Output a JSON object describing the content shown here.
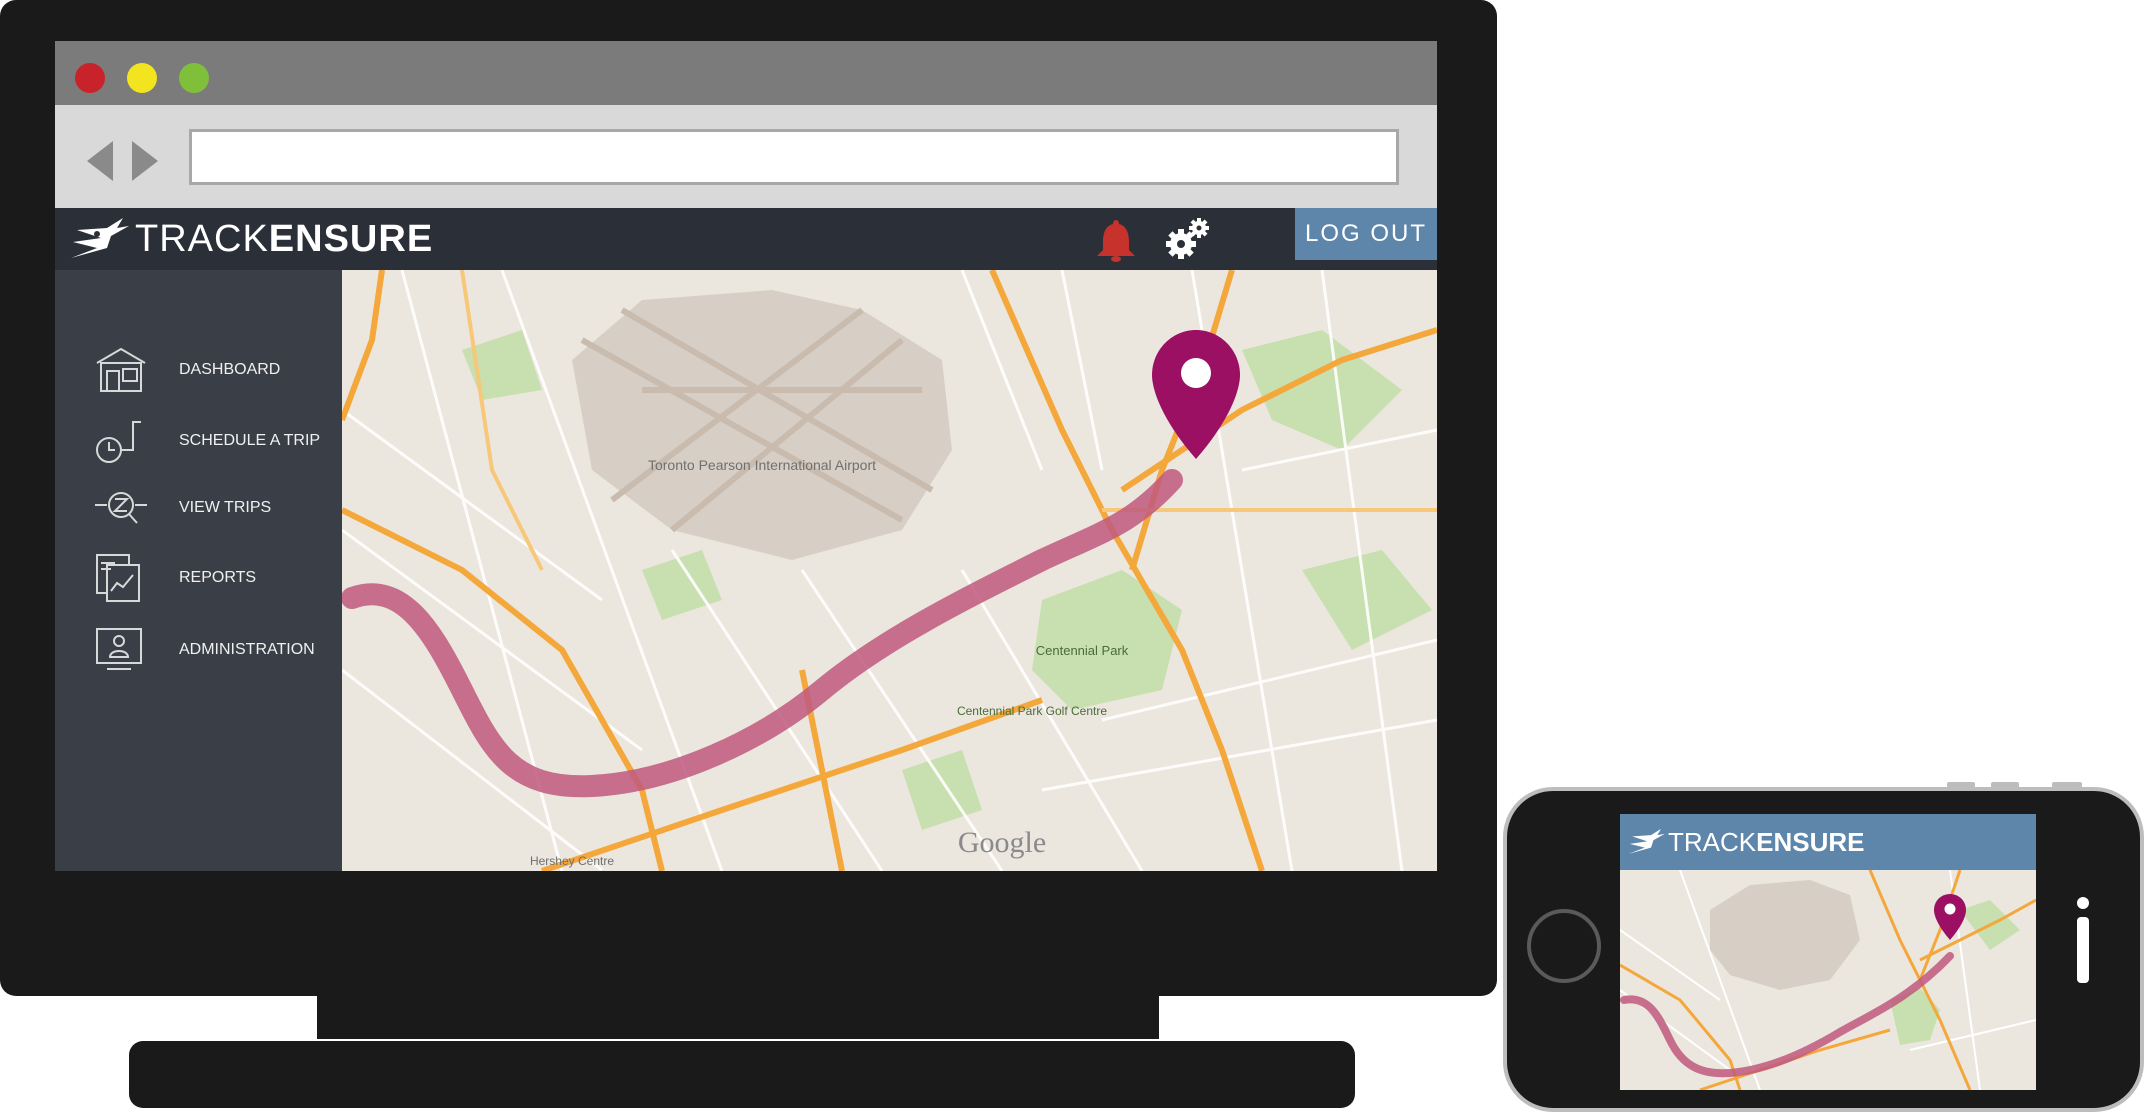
{
  "app": {
    "brand_light": "TRACK",
    "brand_bold": "ENSURE",
    "logout_label": "LOG OUT",
    "colors": {
      "header_bg": "#2b2f37",
      "sidebar_bg": "#3a3f47",
      "accent_blue": "#5e86aa",
      "pin_purple": "#9c1063",
      "route_pink": "#c0587e",
      "bell_red": "#c8322c"
    }
  },
  "browser": {
    "url_value": ""
  },
  "header": {
    "icons": [
      "bell-icon",
      "settings-gears-icon"
    ]
  },
  "sidebar": {
    "items": [
      {
        "label": "DASHBOARD",
        "icon": "dashboard-icon"
      },
      {
        "label": "SCHEDULE A TRIP",
        "icon": "schedule-trip-icon"
      },
      {
        "label": "VIEW TRIPS",
        "icon": "view-trips-icon"
      },
      {
        "label": "REPORTS",
        "icon": "reports-icon"
      },
      {
        "label": "ADMINISTRATION",
        "icon": "administration-icon"
      }
    ]
  },
  "map": {
    "watermark": "Google",
    "labels": {
      "airport": "Toronto Pearson International Airport",
      "park": "Centennial Park",
      "golf": "Centennial Park Golf Centre",
      "centre": "Hershey Centre"
    }
  },
  "mobile": {
    "brand_light": "TRACK",
    "brand_bold": "ENSURE"
  }
}
